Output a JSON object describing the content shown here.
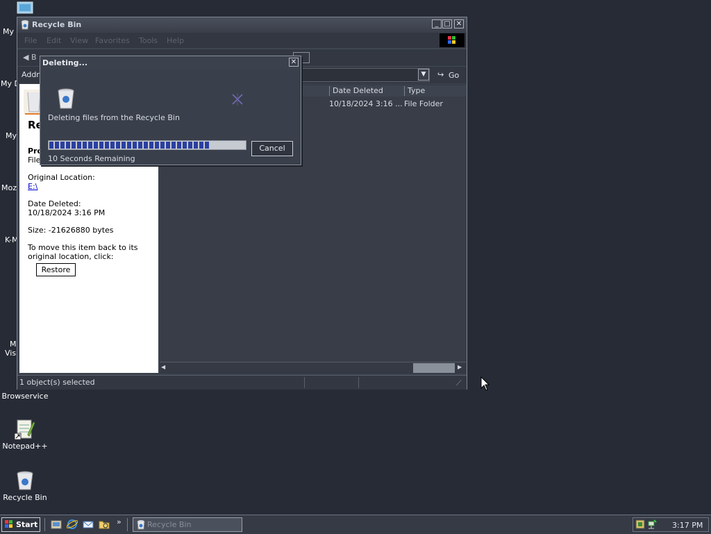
{
  "desktop": {
    "icons": [
      {
        "label": "Browservice",
        "icon": "browser-icon"
      },
      {
        "label": "Notepad++",
        "icon": "notepad-plus-plus-icon"
      },
      {
        "label": "Recycle Bin",
        "icon": "recycle-bin-icon"
      }
    ],
    "clipped_labels": [
      "My",
      "My D",
      "My",
      "Moz",
      "K-M",
      "M",
      "Visu"
    ]
  },
  "window": {
    "title": "Recycle Bin",
    "menu": [
      "File",
      "Edit",
      "View",
      "Favorites",
      "Tools",
      "Help"
    ],
    "toolbar": {
      "back_label": "B"
    },
    "address": {
      "label": "Addre",
      "go_label": "Go"
    },
    "columns": {
      "date_deleted": "Date Deleted",
      "type": "Type"
    },
    "rows": [
      {
        "date_deleted": "10/18/2024 3:16 ...",
        "type": "File Folder"
      }
    ],
    "left_pane": {
      "heading_partial": "Re",
      "item_name_partial": "Pro",
      "item_type_partial": "File",
      "original_location_label": "Original Location:",
      "original_location_value": "E:\\",
      "date_deleted_label": "Date Deleted:",
      "date_deleted_value": "10/18/2024 3:16 PM",
      "size_text": "Size: -21626880 bytes",
      "restore_hint": "To move this item back to its original location, click:",
      "restore_button": "Restore"
    },
    "status": "1 object(s) selected"
  },
  "dialog": {
    "title": "Deleting...",
    "message": "Deleting files from the Recycle Bin",
    "progress": 0.82,
    "remaining": "10 Seconds Remaining",
    "cancel_label": "Cancel"
  },
  "taskbar": {
    "start_label": "Start",
    "quick_launch": [
      "show-desktop-icon",
      "internet-explorer-icon",
      "outlook-express-icon",
      "windows-explorer-icon"
    ],
    "overflow": "»",
    "task_label": "Recycle Bin",
    "clock": "3:17 PM"
  },
  "colors": {
    "desktop": "#262b36",
    "window": "#3b414c",
    "progress": "#2a3fa0",
    "link": "#0000cc"
  }
}
